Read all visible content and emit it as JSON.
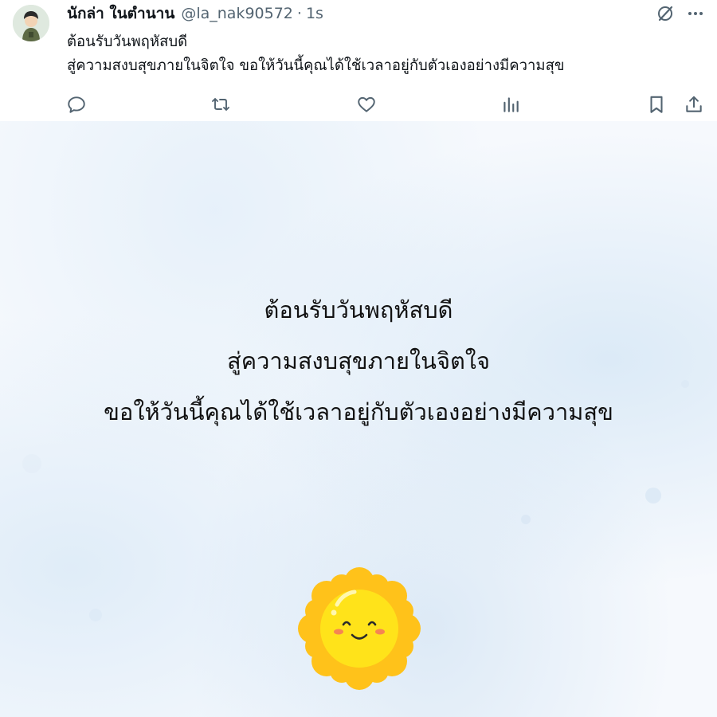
{
  "tweet": {
    "display_name": "นักล่า ในตำนาน",
    "handle": "@la_nak90572",
    "separator": "·",
    "time": "1s",
    "text_lines": [
      "ต้อนรับวันพฤหัสบดี",
      "สู่ความสงบสุขภายในจิตใจ ขอให้วันนี้คุณได้ใช้เวลาอยู่กับตัวเองอย่างมีความสุข"
    ]
  },
  "top_icons": [
    "grok-icon",
    "more-icon"
  ],
  "actions": [
    "reply-icon",
    "retweet-icon",
    "like-icon",
    "views-icon",
    "bookmark-icon",
    "share-icon"
  ],
  "image": {
    "lines": [
      "ต้อนรับวันพฤหัสบดี",
      "สู่ความสงบสุขภายในจิตใจ",
      "ขอให้วันนี้คุณได้ใช้เวลาอยู่กับตัวเองอย่างมีความสุข"
    ],
    "sun_icon": "smiling-sun-icon"
  },
  "colors": {
    "text": "#0f1419",
    "secondary": "#536471",
    "sun_outer": "#ffc21a",
    "sun_inner": "#ffe31a"
  }
}
